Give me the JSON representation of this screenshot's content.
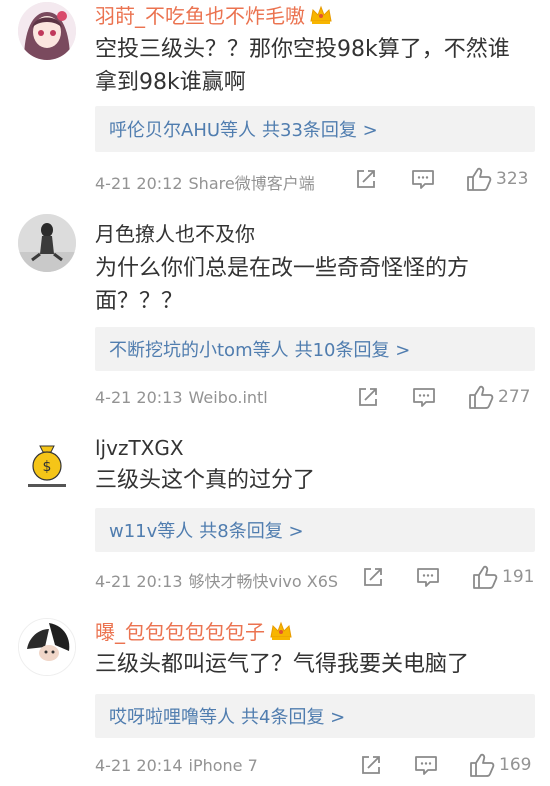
{
  "comments": [
    {
      "username": "羽莳_不吃鱼也不炸毛嗷",
      "text": "空投三级头？？那你空投98k算了，不然谁拿到98k谁赢啊",
      "replies": {
        "users": "呼伦贝尔AHU等人",
        "count_label": "共33条回复 >"
      },
      "time": "4-21 20:12",
      "source": "Share微博客户端",
      "likes": "323"
    },
    {
      "username": "月色撩人也不及你",
      "text": "为什么你们总是在改一些奇奇怪怪的方面？？？",
      "replies": {
        "users": "不断挖坑的小tom等人",
        "count_label": "共10条回复 >"
      },
      "time": "4-21 20:13",
      "source": "Weibo.intl",
      "likes": "277"
    },
    {
      "username": "ljvzTXGX",
      "text": "三级头这个真的过分了",
      "replies": {
        "users": "w11v等人",
        "count_label": "共8条回复 >"
      },
      "time": "4-21 20:13",
      "source": "够快才畅快vivo X6S",
      "likes": "191"
    },
    {
      "username": "曝_包包包包包包子",
      "text": "三级头都叫运气了？气得我要关电脑了",
      "replies": {
        "users": "哎呀啦哩噜等人",
        "count_label": "共4条回复 >"
      },
      "time": "4-21 20:14",
      "source": "iPhone 7",
      "likes": "169"
    }
  ],
  "colors": {
    "vip_name": "#eb7350",
    "link": "#507daf",
    "meta": "#939393",
    "reply_bg": "#f2f2f2"
  },
  "icons": [
    "crown-icon",
    "share-icon",
    "comment-icon",
    "like-icon"
  ]
}
